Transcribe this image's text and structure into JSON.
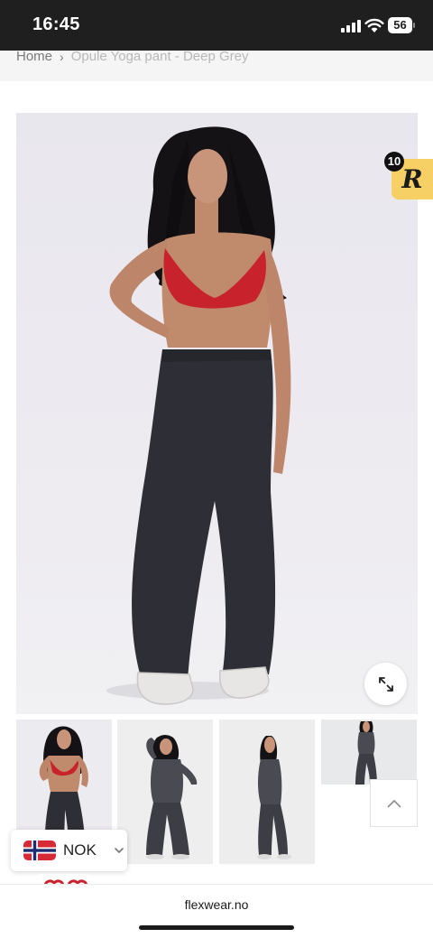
{
  "status_bar": {
    "time": "16:45",
    "battery": "56",
    "icons": [
      "signal-icon",
      "wifi-icon",
      "battery-icon"
    ]
  },
  "breadcrumb": {
    "home": "Home",
    "separator": "›",
    "current": "Opule Yoga pant - Deep Grey"
  },
  "product_gallery": {
    "main_image": "model wearing red sports bra and deep grey flared yoga pants",
    "zoom_icon": "expand-icon",
    "thumbnails": [
      "front view red top",
      "front view grey set",
      "side view grey set",
      "front view grey set far"
    ]
  },
  "rewards_badge": {
    "count": "10",
    "logo": "R"
  },
  "back_to_top_icon": "chevron-up-icon",
  "currency": {
    "code": "NOK",
    "flag": "norway-flag-icon"
  },
  "browser": {
    "url": "flexwear.no"
  },
  "colors": {
    "status_bar_bg": "#1f1f1f",
    "rewards_badge_bg": "#f6cf65",
    "top_red": "#c8232c",
    "pants_grey": "#2e2f36"
  }
}
